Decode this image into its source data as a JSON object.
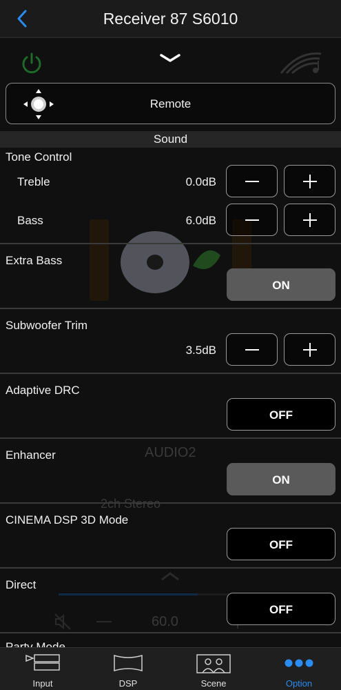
{
  "header": {
    "title": "Receiver 87 S6010"
  },
  "remote": {
    "label": "Remote"
  },
  "section": {
    "title": "Sound"
  },
  "tone_control": {
    "label": "Tone Control",
    "treble": {
      "label": "Treble",
      "value": "0.0dB"
    },
    "bass": {
      "label": "Bass",
      "value": "6.0dB"
    }
  },
  "extra_bass": {
    "label": "Extra Bass",
    "state": "ON"
  },
  "subwoofer_trim": {
    "label": "Subwoofer Trim",
    "value": "3.5dB"
  },
  "adaptive_drc": {
    "label": "Adaptive DRC",
    "state": "OFF"
  },
  "enhancer": {
    "label": "Enhancer",
    "state": "ON"
  },
  "cinema_dsp_3d": {
    "label": "CINEMA DSP 3D Mode",
    "state": "OFF"
  },
  "direct": {
    "label": "Direct",
    "state": "OFF"
  },
  "party_mode": {
    "label": "Party Mode"
  },
  "background": {
    "source": "AUDIO2",
    "mode": "2ch Stereo",
    "volume": "60.0"
  },
  "nav": {
    "input": "Input",
    "dsp": "DSP",
    "scene": "Scene",
    "option": "Option",
    "active": "option"
  },
  "colors": {
    "accent": "#2a8cf0",
    "on_button": "#5a5a5a",
    "background": "#000000"
  }
}
